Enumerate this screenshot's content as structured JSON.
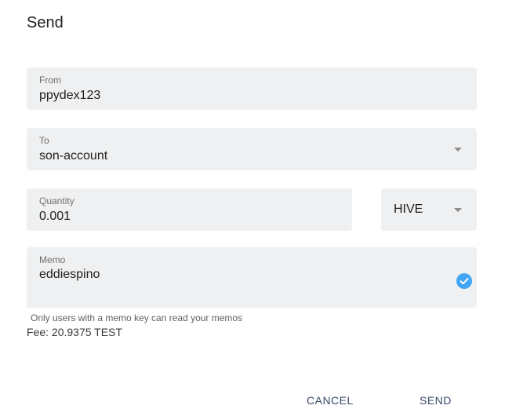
{
  "dialog": {
    "title": "Send"
  },
  "form": {
    "from": {
      "label": "From",
      "value": "ppydex123"
    },
    "to": {
      "label": "To",
      "value": "son-account"
    },
    "quantity": {
      "label": "Quantity",
      "value": "0.001"
    },
    "currency": {
      "value": "HIVE"
    },
    "memo": {
      "label": "Memo",
      "value": "eddiespino",
      "status_icon": "check-circle-icon"
    },
    "memo_helper": "Only users with a memo key can read your memos",
    "fee": "Fee: 20.9375 TEST"
  },
  "actions": {
    "cancel_label": "CANCEL",
    "send_label": "SEND"
  },
  "colors": {
    "field_bg": "#eff0f1",
    "accent": "#42a5f5",
    "button_text": "#3b4a6b"
  }
}
